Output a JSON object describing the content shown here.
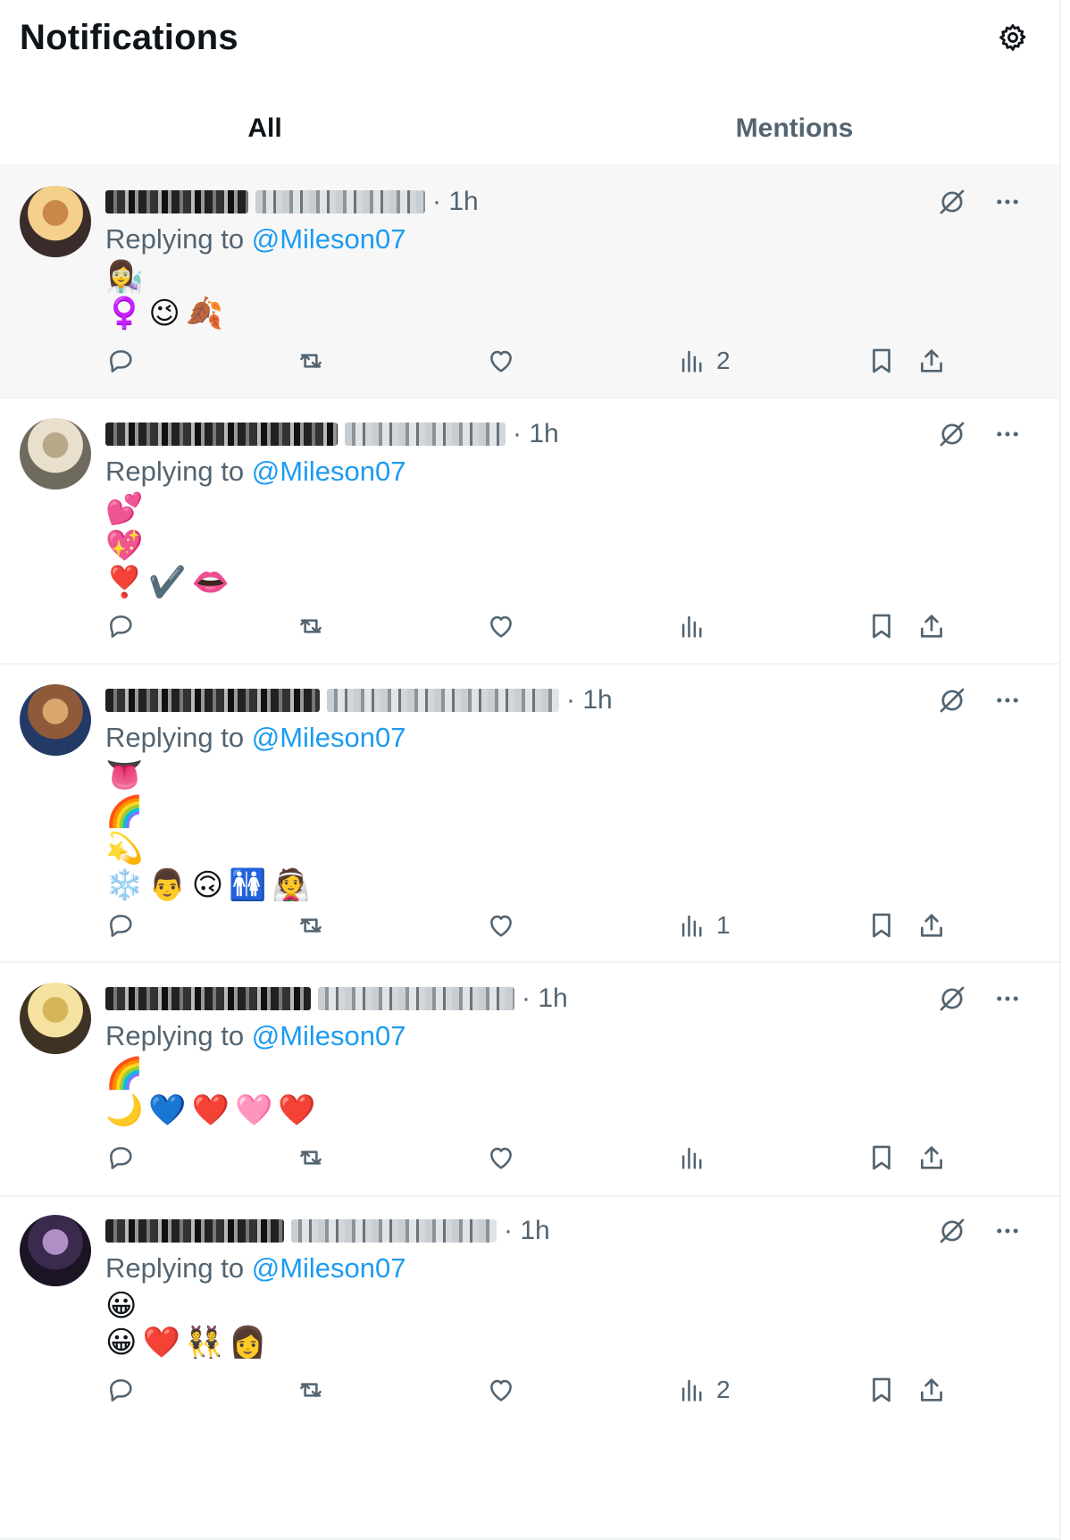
{
  "header": {
    "title": "Notifications"
  },
  "tabs": [
    {
      "label": "All",
      "active": true
    },
    {
      "label": "Mentions",
      "active": false
    }
  ],
  "accent_color": "#1d9bf0",
  "posts": [
    {
      "time": "· 1h",
      "replying_prefix": "Replying to",
      "replying_to": "@Mileson07",
      "emoji_lines": [
        [
          "👩‍🔬"
        ],
        [
          "♀️",
          "😉",
          "🍂"
        ]
      ],
      "views": "2",
      "highlighted": true
    },
    {
      "time": "· 1h",
      "replying_prefix": "Replying to",
      "replying_to": "@Mileson07",
      "emoji_lines": [
        [
          "💕"
        ],
        [
          "💖"
        ],
        [
          "❣️",
          "✔️",
          "👄"
        ]
      ],
      "views": "",
      "highlighted": false
    },
    {
      "time": "· 1h",
      "replying_prefix": "Replying to",
      "replying_to": "@Mileson07",
      "emoji_lines": [
        [
          "👅"
        ],
        [
          "🌈"
        ],
        [
          "💫"
        ],
        [
          "❄️",
          "👨",
          "🙃",
          "🚻",
          "👰"
        ]
      ],
      "views": "1",
      "highlighted": false
    },
    {
      "time": "· 1h",
      "replying_prefix": "Replying to",
      "replying_to": "@Mileson07",
      "emoji_lines": [
        [
          "🌈"
        ],
        [
          "🌙",
          "💙",
          "❤️",
          "🩷",
          "❤️"
        ]
      ],
      "views": "",
      "highlighted": false
    },
    {
      "time": "· 1h",
      "replying_prefix": "Replying to",
      "replying_to": "@Mileson07",
      "emoji_lines": [
        [
          "😀"
        ],
        [
          "😀",
          "❤️",
          "👯",
          "👩"
        ]
      ],
      "views": "2",
      "highlighted": false
    }
  ]
}
